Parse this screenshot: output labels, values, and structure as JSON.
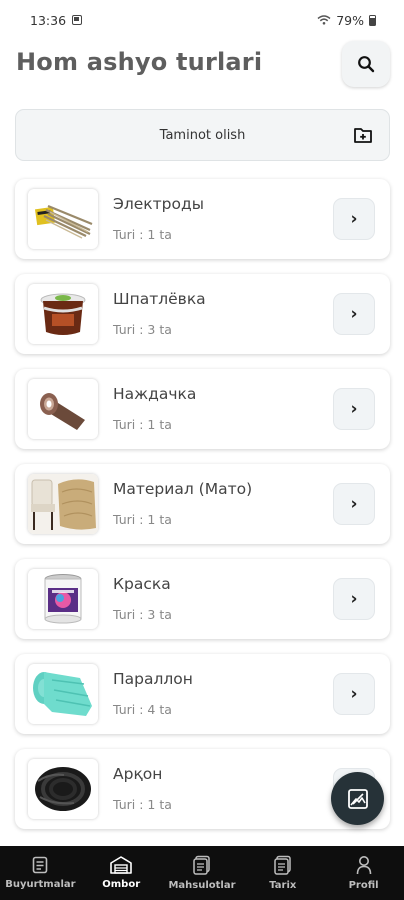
{
  "status_bar": {
    "time": "13:36",
    "battery": "79%"
  },
  "header": {
    "title": "Hom ashyo turlari"
  },
  "supply_button": {
    "label": "Taminot olish"
  },
  "items": [
    {
      "name": "Электроды",
      "count": "Turi : 1 ta",
      "image": "electrodes"
    },
    {
      "name": "Шпатлёвка",
      "count": "Turi : 3 ta",
      "image": "putty-bucket"
    },
    {
      "name": "Наждачка",
      "count": "Turi : 1 ta",
      "image": "sandpaper-roll"
    },
    {
      "name": "Материал (Мато)",
      "count": "Turi : 1 ta",
      "image": "fabric-chairs"
    },
    {
      "name": "Краска",
      "count": "Turi : 3 ta",
      "image": "paint-can"
    },
    {
      "name": "Параллон",
      "count": "Turi : 4 ta",
      "image": "foam-roll"
    },
    {
      "name": "Арқон",
      "count": "Turi : 1 ta",
      "image": "rope-coil"
    }
  ],
  "bottom_nav": [
    {
      "label": "Buyurtmalar",
      "icon": "orders-icon",
      "active": false
    },
    {
      "label": "Ombor",
      "icon": "warehouse-icon",
      "active": true
    },
    {
      "label": "Mahsulotlar",
      "icon": "products-icon",
      "active": false
    },
    {
      "label": "Tarix",
      "icon": "history-icon",
      "active": false
    },
    {
      "label": "Profil",
      "icon": "profile-icon",
      "active": false
    }
  ],
  "colors": {
    "nav_background": "#0e0e0e",
    "fab_background": "#263238",
    "title": "#5e5e5e"
  }
}
